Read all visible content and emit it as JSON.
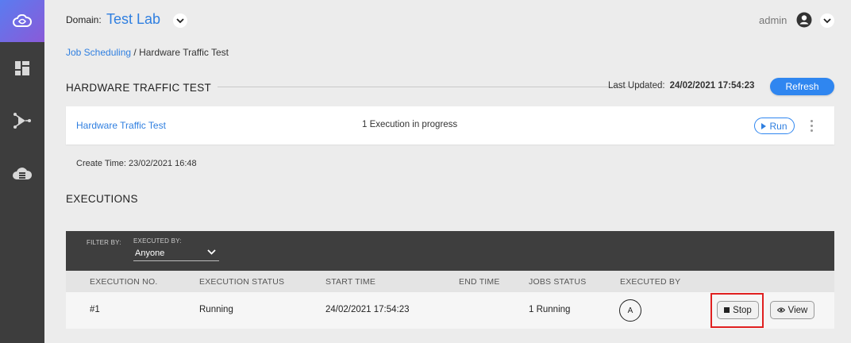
{
  "sidebar": {
    "items": [
      {
        "icon": "cloud-logo-icon"
      },
      {
        "icon": "dashboard-icon"
      },
      {
        "icon": "topology-icon"
      },
      {
        "icon": "cloud-storage-icon"
      }
    ]
  },
  "header": {
    "domain_label": "Domain:",
    "domain_value": "Test Lab",
    "user": "admin"
  },
  "breadcrumb": {
    "link": "Job Scheduling",
    "separator": " / ",
    "current": "Hardware Traffic Test"
  },
  "job": {
    "section_title": "HARDWARE TRAFFIC TEST",
    "last_updated_label": "Last Updated:",
    "last_updated_value": "24/02/2021 17:54:23",
    "refresh_label": "Refresh",
    "name": "Hardware Traffic Test",
    "status": "1 Execution in progress",
    "run_label": "Run",
    "create_time_label": "Create Time:",
    "create_time_value": "23/02/2021 16:48"
  },
  "executions": {
    "title": "EXECUTIONS",
    "filter_label": "FILTER BY:",
    "executed_by_label": "EXECUTED BY:",
    "executed_by_value": "Anyone",
    "columns": [
      "EXECUTION NO.",
      "EXECUTION STATUS",
      "START TIME",
      "END TIME",
      "JOBS STATUS",
      "EXECUTED BY"
    ],
    "rows": [
      {
        "number": "#1",
        "status": "Running",
        "start_time": "24/02/2021 17:54:23",
        "end_time": "",
        "jobs_status": "1 Running",
        "executed_by": "A",
        "stop_label": "Stop",
        "view_label": "View"
      }
    ]
  },
  "colors": {
    "accent": "#2f86f0",
    "sidebar": "#3d3d3d",
    "highlight": "#e02020"
  }
}
